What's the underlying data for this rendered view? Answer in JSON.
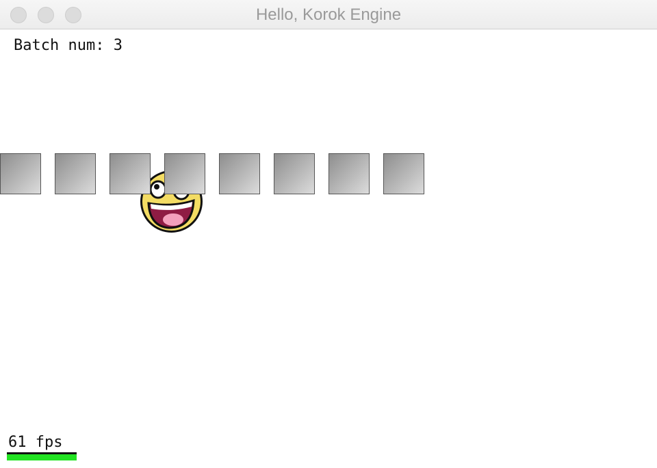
{
  "window": {
    "title": "Hello, Korok Engine"
  },
  "hud": {
    "batch_label": "Batch num: 3",
    "fps_label": "61 fps",
    "fps_bar_fraction": 1.0
  },
  "scene": {
    "sprite_count": 8,
    "sprites": [
      "gray-square",
      "gray-square",
      "gray-square",
      "gray-square",
      "gray-square",
      "gray-square",
      "gray-square",
      "gray-square"
    ],
    "face": "awesome-smiley-face"
  },
  "colors": {
    "fps_bar": "#22e322",
    "face_fill": "#f3dc63",
    "mouth_fill": "#8f1c44",
    "tongue_fill": "#f4a0bd"
  }
}
